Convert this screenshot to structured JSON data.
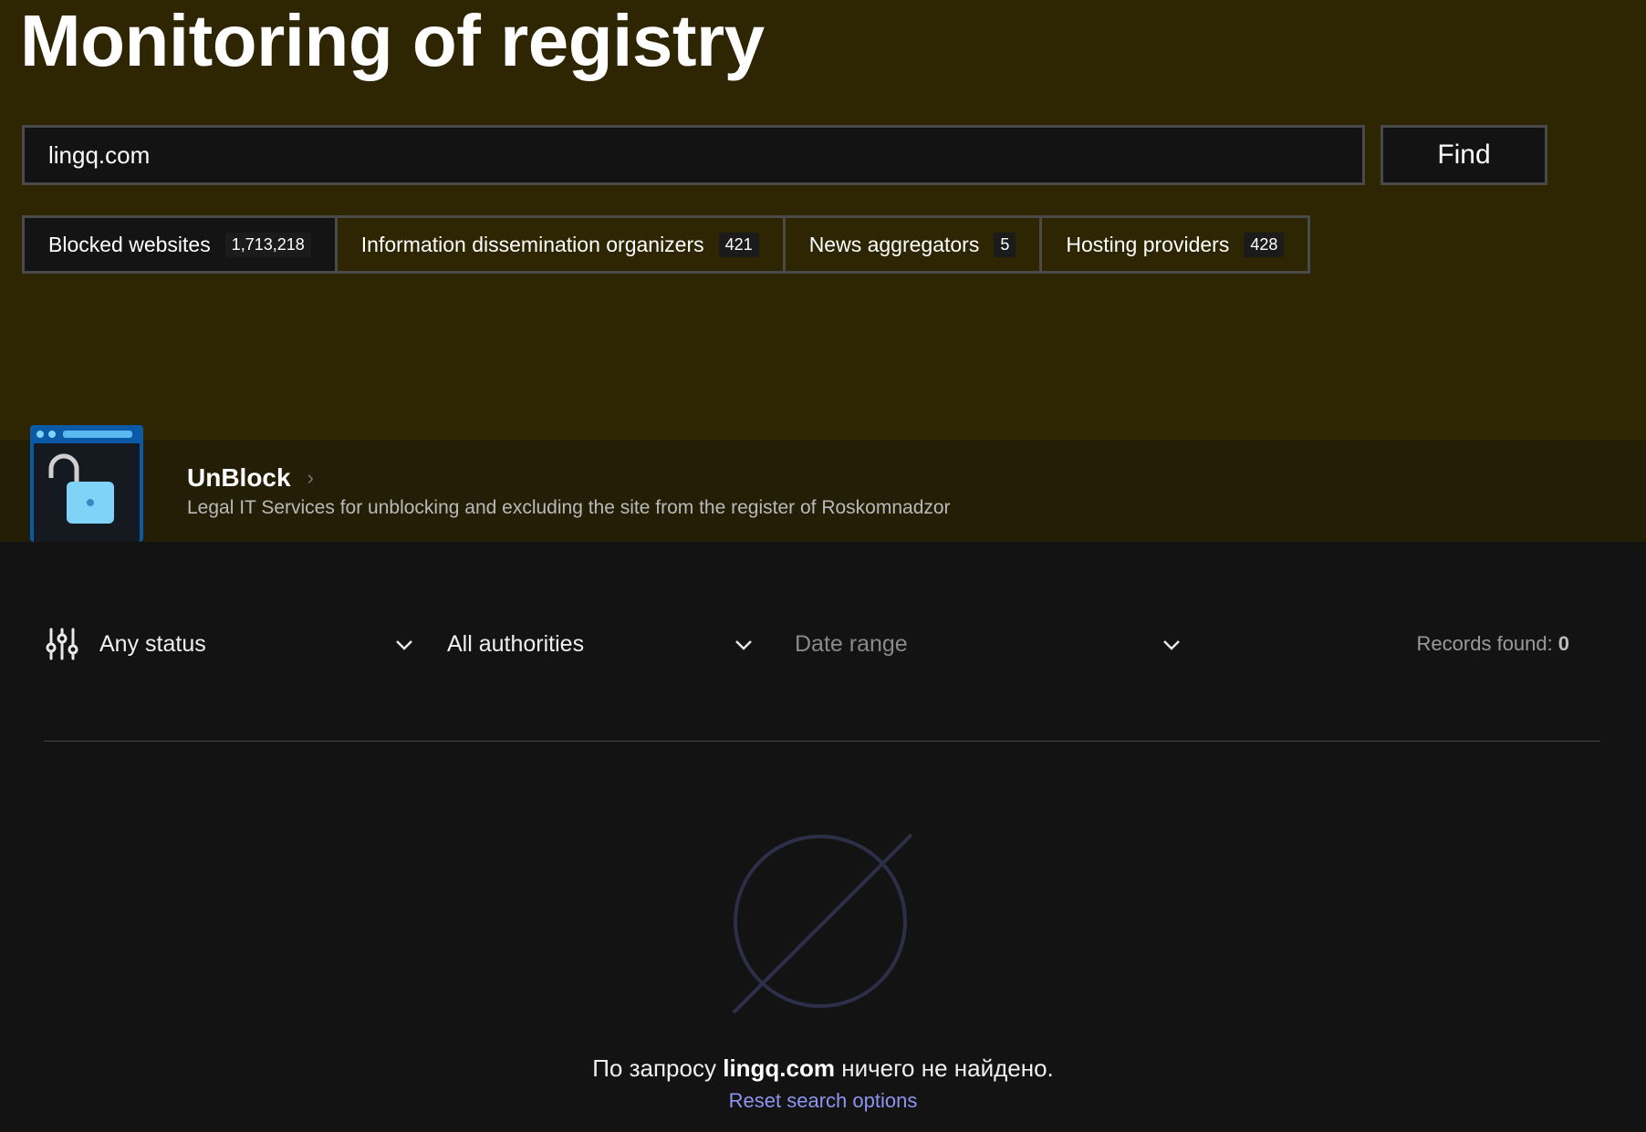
{
  "header": {
    "title": "Monitoring of registry"
  },
  "search": {
    "value": "lingq.com",
    "button_label": "Find"
  },
  "tabs": [
    {
      "label": "Blocked websites",
      "count": "1,713,218",
      "active": true
    },
    {
      "label": "Information dissemination organizers",
      "count": "421",
      "active": false
    },
    {
      "label": "News aggregators",
      "count": "5",
      "active": false
    },
    {
      "label": "Hosting providers",
      "count": "428",
      "active": false
    }
  ],
  "promo": {
    "title": "UnBlock",
    "chevron": "›",
    "description": "Legal IT Services for unblocking and excluding the site from the register of Roskomnadzor",
    "icon": "unlocked-padlock-icon"
  },
  "filters": {
    "status": "Any status",
    "authority": "All authorities",
    "date_placeholder": "Date range",
    "records_label": "Records found:",
    "records_count": "0"
  },
  "empty_state": {
    "prefix": "По запросу",
    "query": "lingq.com",
    "suffix": "ничего не найдено.",
    "reset_label": "Reset search options",
    "icon": "empty-set-icon"
  },
  "colors": {
    "hero_bg": "#2e2502",
    "promo_bg": "#251e07",
    "page_bg": "#131313",
    "link": "#8e94f0"
  }
}
